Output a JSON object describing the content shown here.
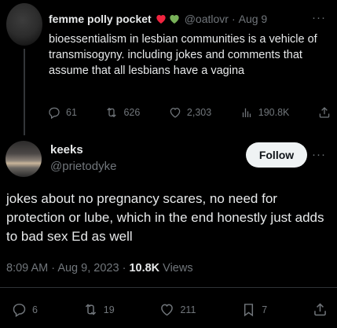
{
  "parent_tweet": {
    "author_name": "femme polly pocket",
    "name_emoji": [
      "red-heart",
      "green-heart"
    ],
    "handle": "@oatlovr",
    "separator": "·",
    "date": "Aug 9",
    "more": "···",
    "text": "bioessentialism in lesbian communities is a vehicle of transmisogyny. including jokes and comments that assume that all lesbians have a vagina",
    "replies": "61",
    "reposts": "626",
    "likes": "2,303",
    "views": "190.8K"
  },
  "main_tweet": {
    "author_name": "keeks",
    "handle": "@prietodyke",
    "follow_label": "Follow",
    "more": "···",
    "text": "jokes about no pregnancy scares, no need for protection or lube, which in the end honestly just adds to bad sex Ed as well",
    "time": "8:09 AM",
    "separator": "·",
    "date": "Aug 9, 2023",
    "separator2": "·",
    "views_count": "10.8K",
    "views_label": "Views",
    "replies": "6",
    "reposts": "19",
    "likes": "211",
    "bookmarks": "7"
  },
  "colors": {
    "background": "#000000",
    "text": "#e7e9ea",
    "muted": "#71767b",
    "heart_red": "#f0243f",
    "heart_green": "#78b159"
  }
}
